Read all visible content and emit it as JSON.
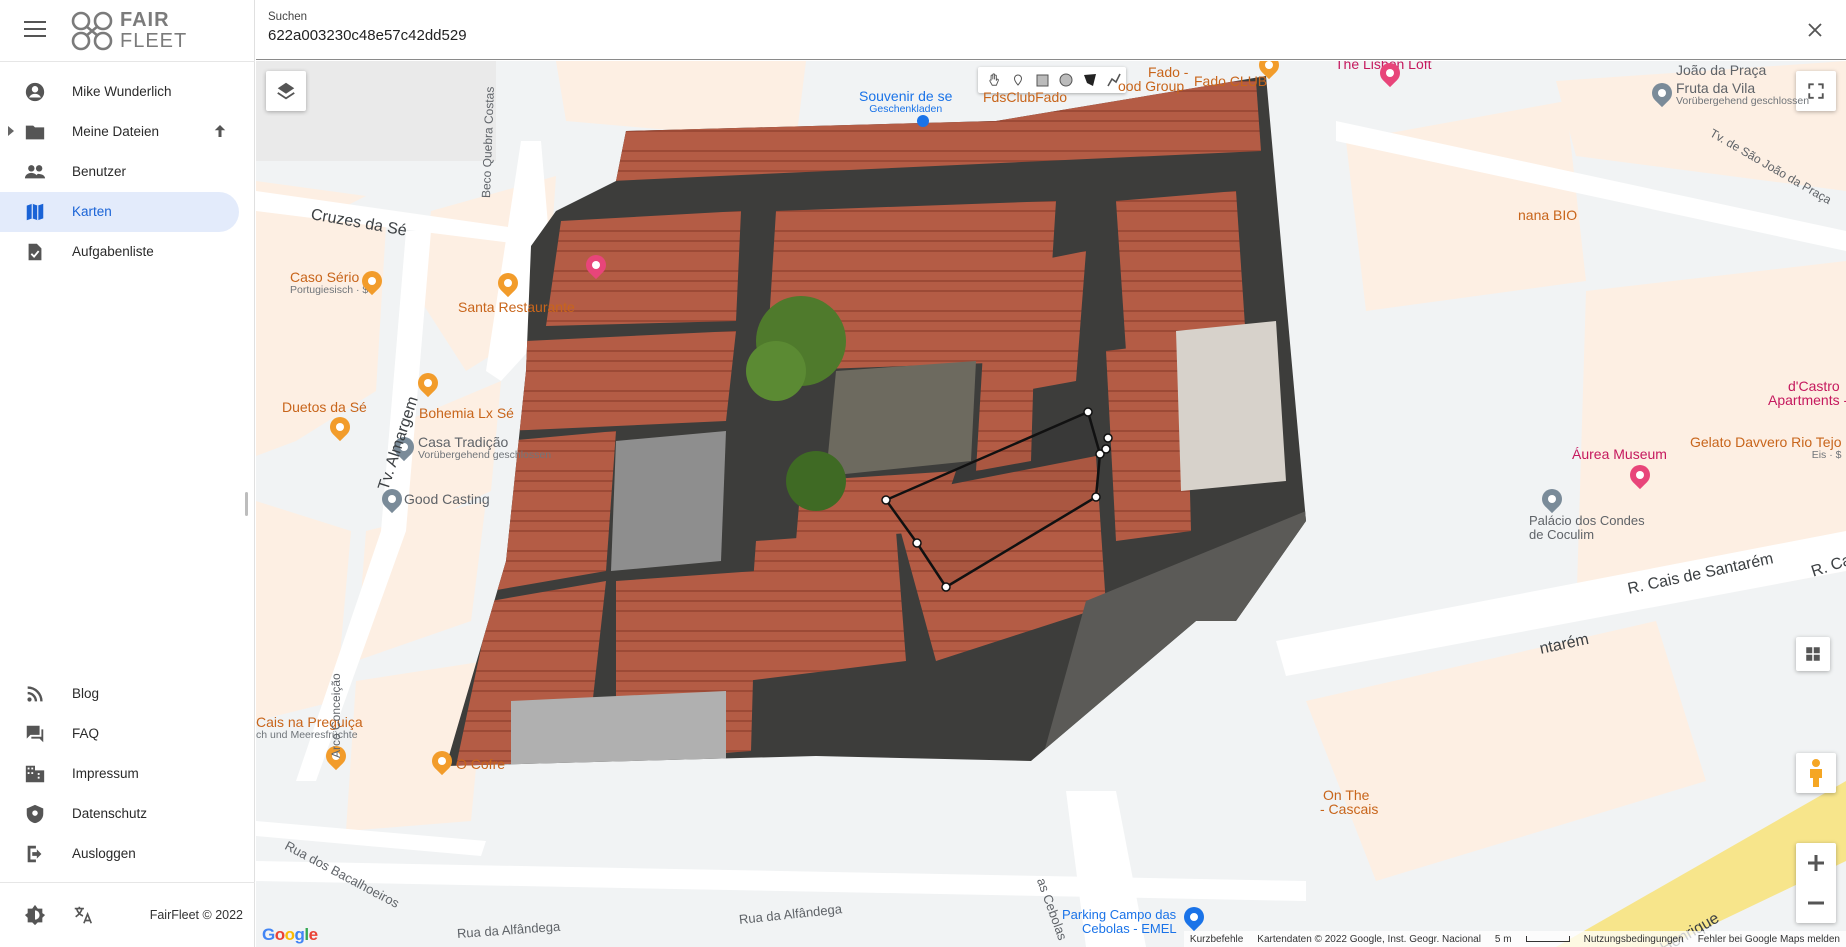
{
  "app": {
    "logo_line1": "FAIR",
    "logo_line2": "FLEET",
    "copyright": "FairFleet © 2022",
    "accent": "#1a63d6"
  },
  "sidebar": {
    "user_name": "Mike Wunderlich",
    "items": [
      {
        "label": "Meine Dateien",
        "icon": "folder-icon"
      },
      {
        "label": "Benutzer",
        "icon": "people-icon"
      },
      {
        "label": "Karten",
        "icon": "map-icon",
        "active": true
      },
      {
        "label": "Aufgabenliste",
        "icon": "task-icon"
      }
    ],
    "bottom_items": [
      {
        "label": "Blog",
        "icon": "rss-icon"
      },
      {
        "label": "FAQ",
        "icon": "chat-icon"
      },
      {
        "label": "Impressum",
        "icon": "building-icon"
      },
      {
        "label": "Datenschutz",
        "icon": "shield-icon"
      },
      {
        "label": "Ausloggen",
        "icon": "logout-icon"
      }
    ]
  },
  "search": {
    "label": "Suchen",
    "value": "622a003230c48e57c42dd529"
  },
  "map": {
    "pois": {
      "souvenir": "Souvenir de se",
      "souvenir_sub": "Geschenkladen",
      "fado_group": "Fado -",
      "fado_group2": "ood Group",
      "fado_club": "Fado CLUB",
      "fdsclubfado": "FdsClubFado",
      "lisbon_loft": "The Lisbon Loft",
      "joao_praca": "João da Praça",
      "fruta_vila": "Fruta da Vila",
      "fruta_vila_sub": "Vorübergehend geschlossen",
      "banana_bio": "nana BIO",
      "caso_serio": "Caso Sério",
      "caso_serio_sub": "Portugiesisch · $",
      "santa": "Santa Restaurante",
      "duetos": "Duetos da Sé",
      "bohemia": "Bohemia Lx Sé",
      "casa_tradicao": "Casa Tradição",
      "casa_tradicao_sub": "Vorübergehend geschlossen",
      "good_casting": "Good Casting",
      "castro": "d'Castro",
      "apartments": "Apartments - S",
      "aurea": "Áurea Museum",
      "gelato": "Gelato Davvero Rio Tejo",
      "gelato_sub": "Eis · $",
      "palacio": "Palácio dos Condes",
      "palacio2": "de Coculim",
      "cais_preguica": "Cais na Preguiça",
      "cais_preguica_sub": "ch und Meeresfrüchte",
      "o_cofre": "O Cofre",
      "on_the": "On The",
      "cascais": "- Cascais",
      "parking": "Parking Campo das",
      "parking2": "Cebolas - EMEL"
    },
    "streets": {
      "cruzes": "Cruzes da Sé",
      "beco": "Beco Quebra Costas",
      "almargem": "Tv. Almargem",
      "sao_joao": "Tv. de São João da Praça",
      "santarem": "R. Cais de Santarém",
      "santarem2": "ntarém",
      "rc": "R. Ca",
      "arco": "Arco Conceição",
      "bacalhoeiros": "Rua dos Bacalhoeiros",
      "alfandega": "Rua da Alfândega",
      "alfandega2": "Rua da Alfândega",
      "cebolas": "as Cebolas",
      "henrique": "Henrique"
    },
    "attribution": {
      "shortcuts": "Kurzbefehle",
      "data": "Kartendaten © 2022 Google, Inst. Geogr. Nacional",
      "scale": "5 m",
      "terms": "Nutzungsbedingungen",
      "report": "Fehler bei Google Maps melden",
      "google": "Google"
    }
  }
}
